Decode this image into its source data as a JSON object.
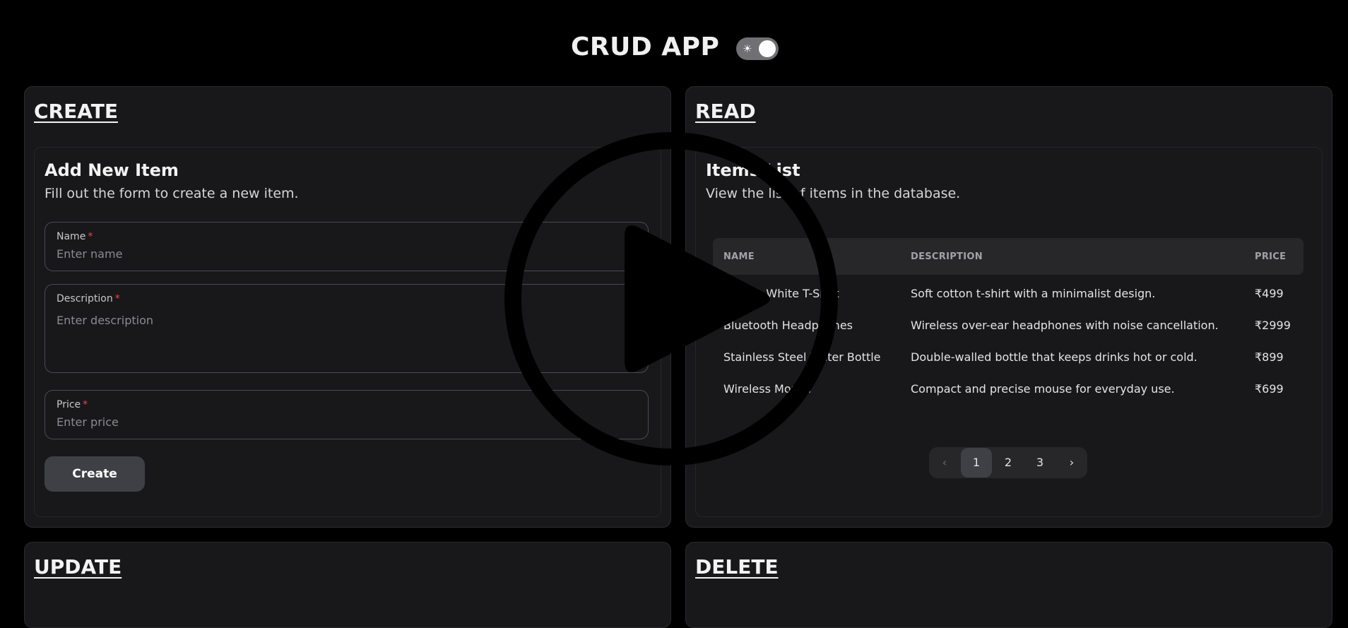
{
  "header": {
    "title": "CRUD APP",
    "toggle_icon": "sun-icon"
  },
  "create": {
    "section_title": "CREATE",
    "card_title": "Add New Item",
    "card_subtitle": "Fill out the form to create a new item.",
    "fields": {
      "name": {
        "label": "Name",
        "required_mark": "*",
        "placeholder": "Enter name"
      },
      "description": {
        "label": "Description",
        "required_mark": "*",
        "placeholder": "Enter description"
      },
      "price": {
        "label": "Price",
        "required_mark": "*",
        "placeholder": "Enter price"
      }
    },
    "button_label": "Create"
  },
  "read": {
    "section_title": "READ",
    "card_title": "Items List",
    "card_subtitle": "View the list of items in the database.",
    "columns": [
      "NAME",
      "DESCRIPTION",
      "PRICE"
    ],
    "rows": [
      {
        "name": "Classic White T-Shirt",
        "description": "Soft cotton t-shirt with a minimalist design.",
        "price": "₹499"
      },
      {
        "name": "Bluetooth Headphones",
        "description": "Wireless over-ear headphones with noise cancellation.",
        "price": "₹2999"
      },
      {
        "name": "Stainless Steel Water Bottle",
        "description": "Double-walled bottle that keeps drinks hot or cold.",
        "price": "₹899"
      },
      {
        "name": "Wireless Mouse",
        "description": "Compact and precise mouse for everyday use.",
        "price": "₹699"
      }
    ],
    "pagination": {
      "prev": "‹",
      "pages": [
        "1",
        "2",
        "3"
      ],
      "next": "›",
      "current": "1"
    }
  },
  "update": {
    "section_title": "UPDATE"
  },
  "delete": {
    "section_title": "DELETE"
  },
  "overlay": {
    "icon": "play-icon"
  }
}
